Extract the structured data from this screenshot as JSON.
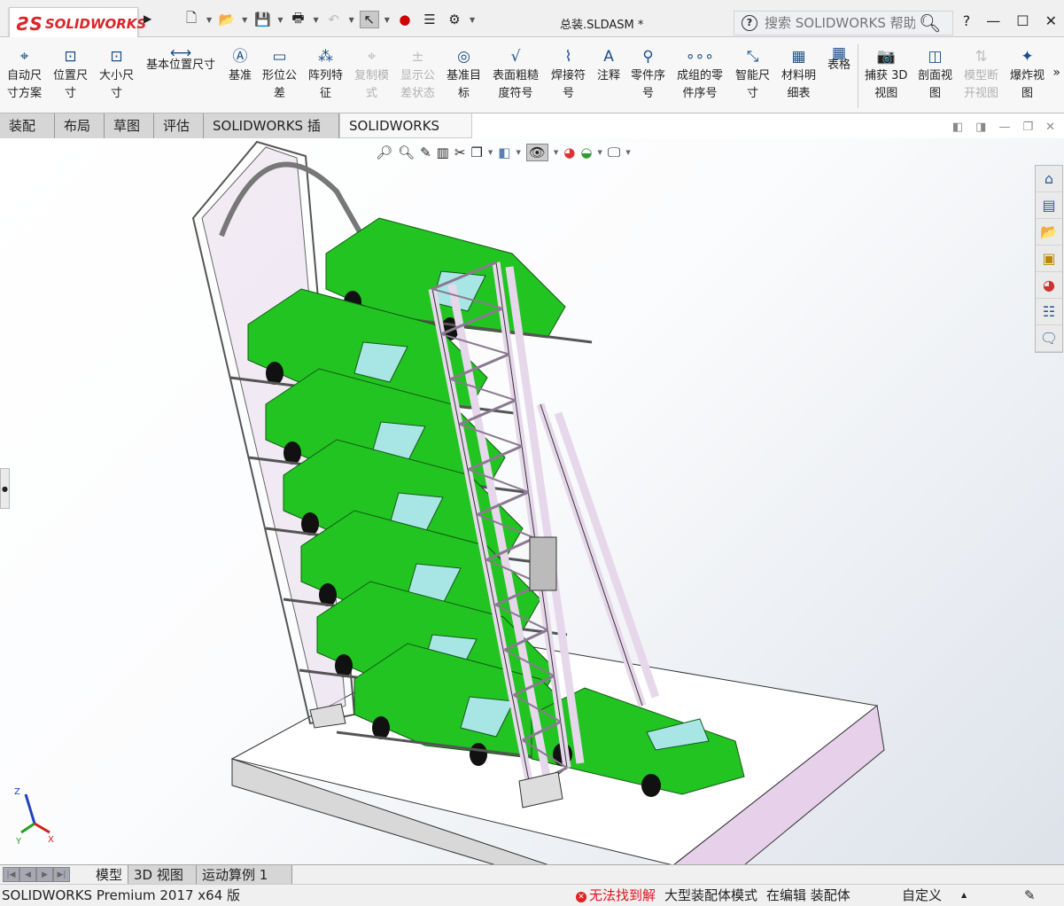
{
  "app": {
    "logo": "SOLIDWORKS",
    "document_title": "总装.SLDASM *"
  },
  "quick_access": {
    "icons": [
      "new-document-icon",
      "open-icon",
      "save-icon",
      "print-icon",
      "undo-icon",
      "select-icon",
      "rebuild-icon",
      "file-properties-icon",
      "options-icon"
    ]
  },
  "search": {
    "placeholder": "搜索 SOLIDWORKS 帮助"
  },
  "window": {
    "help": "?",
    "minimize": "—",
    "maximize": "☐",
    "close": "✕"
  },
  "ribbon": {
    "items": [
      {
        "label": "自动尺\n寸方案",
        "enabled": true
      },
      {
        "label": "位置尺\n寸",
        "enabled": true
      },
      {
        "label": "大小尺\n寸",
        "enabled": true
      },
      {
        "label": "基本位置尺寸",
        "enabled": true
      },
      {
        "label": "基准",
        "enabled": true
      },
      {
        "label": "形位公\n差",
        "enabled": true
      },
      {
        "label": "阵列特\n征",
        "enabled": true
      },
      {
        "label": "复制模\n式",
        "enabled": false
      },
      {
        "label": "显示公\n差状态",
        "enabled": false
      },
      {
        "label": "基准目\n标",
        "enabled": true
      },
      {
        "label": "表面粗糙\n度符号",
        "enabled": true
      },
      {
        "label": "焊接符\n号",
        "enabled": true
      },
      {
        "label": "注释",
        "enabled": true
      },
      {
        "label": "零件序\n号",
        "enabled": true
      },
      {
        "label": "成组的零\n件序号",
        "enabled": true
      },
      {
        "label": "智能尺\n寸",
        "enabled": true
      },
      {
        "label": "材料明\n细表",
        "enabled": true
      },
      {
        "label": "表格",
        "enabled": true
      },
      {
        "label": "捕获 3D\n视图",
        "enabled": true
      },
      {
        "label": "剖面视\n图",
        "enabled": true
      },
      {
        "label": "模型断\n开视图",
        "enabled": false
      },
      {
        "label": "爆炸视\n图",
        "enabled": true
      }
    ],
    "more": "»"
  },
  "command_tabs": [
    "装配体",
    "布局",
    "草图",
    "评估",
    "SOLIDWORKS 插件",
    "SOLIDWORKS MBD"
  ],
  "active_command_tab": "SOLIDWORKS MBD",
  "bottom_tabs": [
    "模型",
    "3D 视图",
    "运动算例 1"
  ],
  "active_bottom_tab": "模型",
  "status": {
    "product": "SOLIDWORKS Premium 2017 x64 版",
    "error": "无法找到解",
    "mode": "大型装配体模式",
    "editing": "在编辑 装配体",
    "units": "自定义"
  },
  "triad": {
    "x": "X",
    "y": "Y",
    "z": "Z"
  },
  "colors": {
    "car": "#22c422",
    "frame": "#e6d8ea",
    "accent": "#d9262a",
    "error": "#e0141e"
  }
}
